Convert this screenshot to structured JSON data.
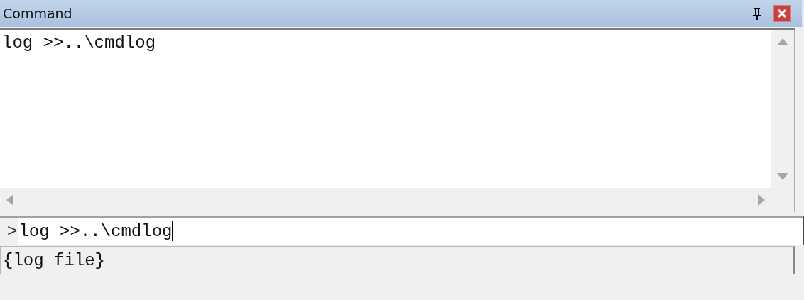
{
  "window": {
    "title": "Command"
  },
  "output": {
    "lines": [
      "log >>..\\cmdlog"
    ]
  },
  "command_line": {
    "prompt": ">",
    "value": "log >>..\\cmdlog"
  },
  "status_bar": {
    "text": "{log file}"
  }
}
